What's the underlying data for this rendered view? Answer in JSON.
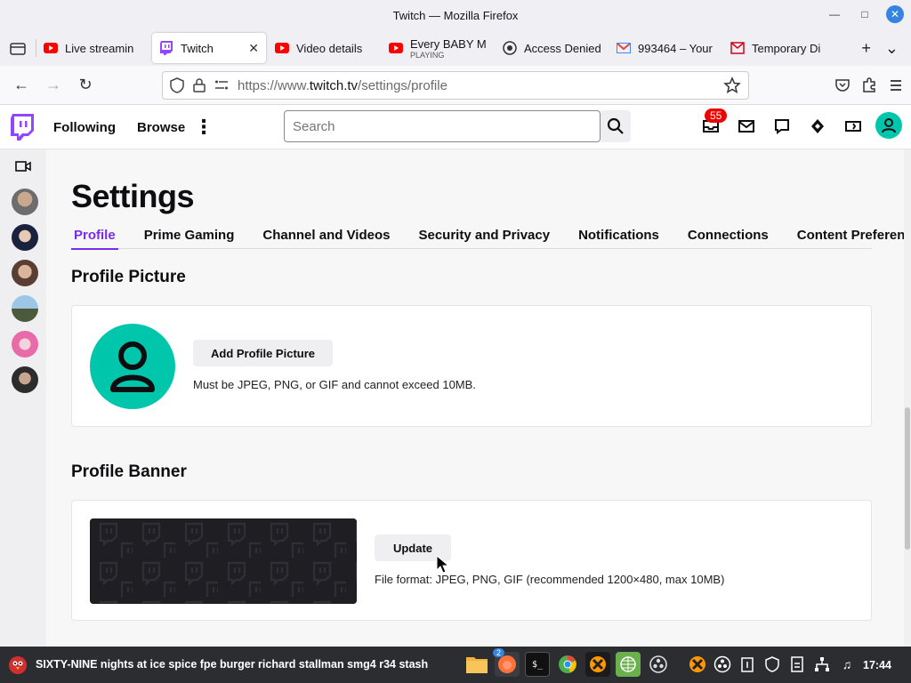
{
  "window": {
    "title": "Twitch — Mozilla Firefox"
  },
  "tabs": [
    {
      "label": "Live streamin",
      "sub": "",
      "favicon": "youtube-icon",
      "active": false
    },
    {
      "label": "Twitch",
      "sub": "",
      "favicon": "twitch-icon",
      "active": true
    },
    {
      "label": "Video details",
      "sub": "",
      "favicon": "youtube-icon",
      "active": false
    },
    {
      "label": "Every BABY M",
      "sub": "PLAYING",
      "favicon": "youtube-icon",
      "active": false
    },
    {
      "label": "Access Denied",
      "sub": "",
      "favicon": "shield-icon",
      "active": false
    },
    {
      "label": "993464 – Your",
      "sub": "",
      "favicon": "gmail-icon",
      "active": false
    },
    {
      "label": "Temporary Di",
      "sub": "",
      "favicon": "mail-icon",
      "active": false
    }
  ],
  "urlbar": {
    "prefix": "https://www.",
    "domain": "twitch.tv",
    "path": "/settings/profile"
  },
  "twitch": {
    "nav": {
      "following": "Following",
      "browse": "Browse"
    },
    "search_placeholder": "Search",
    "notif_count": "55",
    "accent": "#9146ff",
    "avatar_color": "#00c7ac"
  },
  "settings": {
    "title": "Settings",
    "tabs": [
      "Profile",
      "Prime Gaming",
      "Channel and Videos",
      "Security and Privacy",
      "Notifications",
      "Connections",
      "Content Preferences"
    ],
    "active_tab": "Profile",
    "profile_picture": {
      "heading": "Profile Picture",
      "button": "Add Profile Picture",
      "hint": "Must be JPEG, PNG, or GIF and cannot exceed 10MB."
    },
    "profile_banner": {
      "heading": "Profile Banner",
      "button": "Update",
      "hint": "File format: JPEG, PNG, GIF (recommended 1200×480, max 10MB)"
    }
  },
  "taskbar": {
    "window_title": "SIXTY-NINE nights at ice spice fpe burger richard stallman smg4 r34 stash",
    "badge": "2",
    "clock": "17:44"
  }
}
